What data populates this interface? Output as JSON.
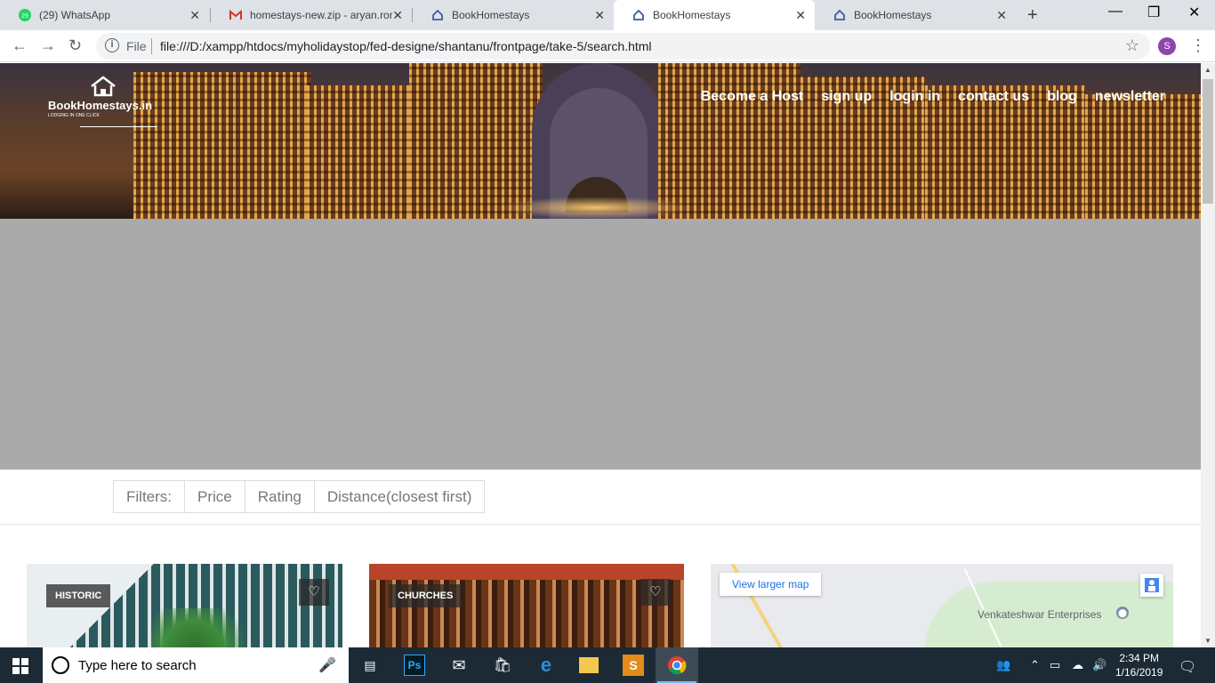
{
  "browser": {
    "tabs": [
      {
        "title": "(29) WhatsApp",
        "favicon": "whatsapp-icon",
        "badge": "29",
        "active": false
      },
      {
        "title": "homestays-new.zip - aryan.ror",
        "favicon": "gmail-icon",
        "active": false
      },
      {
        "title": "BookHomestays",
        "favicon": "house-icon",
        "active": false
      },
      {
        "title": "BookHomestays",
        "favicon": "house-icon",
        "active": true
      },
      {
        "title": "BookHomestays",
        "favicon": "house-icon",
        "active": false
      }
    ],
    "tab_close": "✕",
    "new_tab": "+",
    "window_controls": {
      "minimize": "—",
      "maximize": "❐",
      "close": "✕"
    },
    "address": {
      "scheme_label": "File",
      "info": "i",
      "url": "file:///D:/xampp/htdocs/myholidaystop/fed-designe/shantanu/frontpage/take-5/search.html"
    },
    "profile_initial": "S",
    "nav": {
      "back": "←",
      "forward": "→",
      "reload": "↻",
      "star": "☆",
      "menu": "⋮"
    }
  },
  "site": {
    "logo": {
      "name": "BookHomestays.in",
      "tagline": "LODGING IN ONE CLICK"
    },
    "nav_links": [
      "Become a Host",
      "sign up",
      "login in",
      "contact us",
      "blog",
      "newsletter"
    ],
    "filters": {
      "label": "Filters:",
      "options": [
        "Price",
        "Rating",
        "Distance(closest first)"
      ]
    },
    "cards": [
      {
        "tag": "HISTORIC",
        "heart": "♡"
      },
      {
        "tag": "CHURCHES",
        "heart": "♡"
      }
    ],
    "map": {
      "larger_link": "View larger map",
      "place": "Venkateshwar Enterprises"
    }
  },
  "taskbar": {
    "search_placeholder": "Type here to search",
    "apps": [
      "task-view-icon",
      "photoshop-icon",
      "mail-icon",
      "store-icon",
      "edge-icon",
      "file-explorer-icon",
      "sublime-text-icon",
      "chrome-icon"
    ],
    "time": "2:34 PM",
    "date": "1/16/2019"
  },
  "colors": {
    "accent_blue": "#1a73e8",
    "hero_gold": "#e7a64a",
    "grey_band": "#aaaaaa"
  }
}
